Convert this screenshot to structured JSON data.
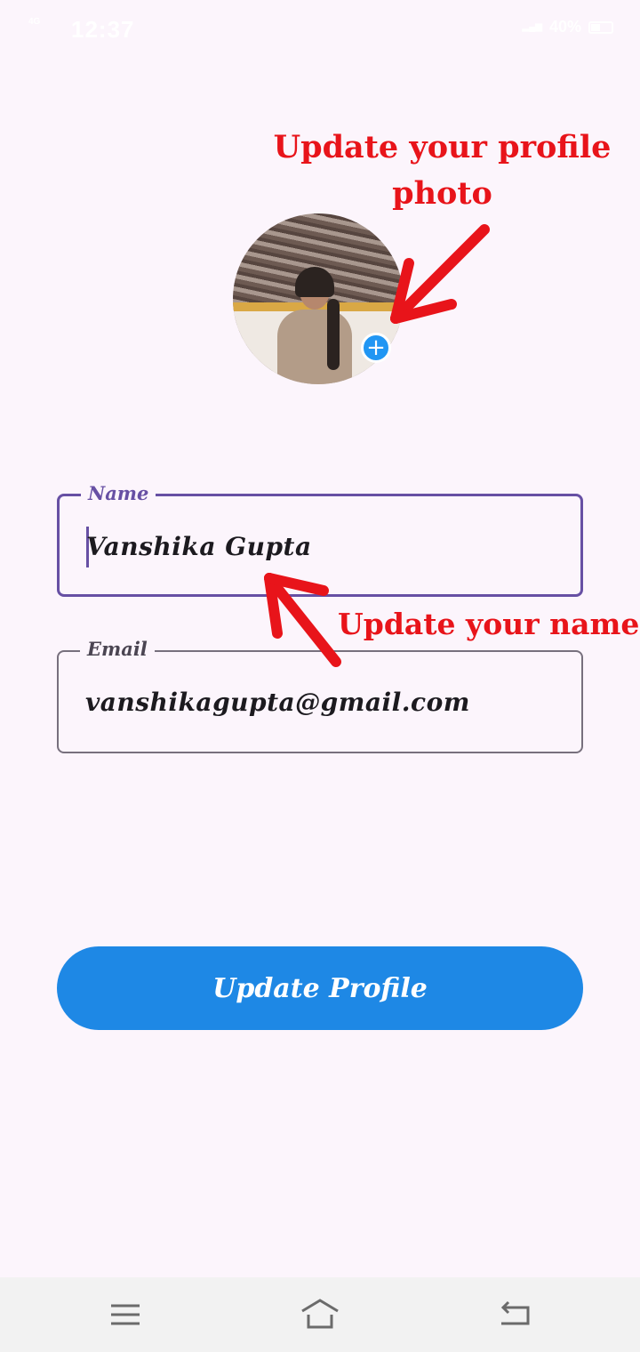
{
  "status_bar": {
    "network": "4G",
    "time": "12:37",
    "battery": "40%"
  },
  "annotations": {
    "photo": "Update your profile photo",
    "name": "Update your name"
  },
  "profile": {
    "name_label": "Name",
    "name_value": "Vanshika Gupta",
    "email_label": "Email",
    "email_value": "vanshikagupta@gmail.com",
    "add_photo_icon": "+"
  },
  "actions": {
    "update_label": "Update Profile"
  },
  "colors": {
    "accent": "#6750a4",
    "button": "#1e88e5",
    "annotation": "#e8141a",
    "background": "#fcf5fc"
  },
  "icons": {
    "add_photo": "plus-icon",
    "nav_menu": "menu-icon",
    "nav_home": "home-icon",
    "nav_back": "back-icon"
  }
}
